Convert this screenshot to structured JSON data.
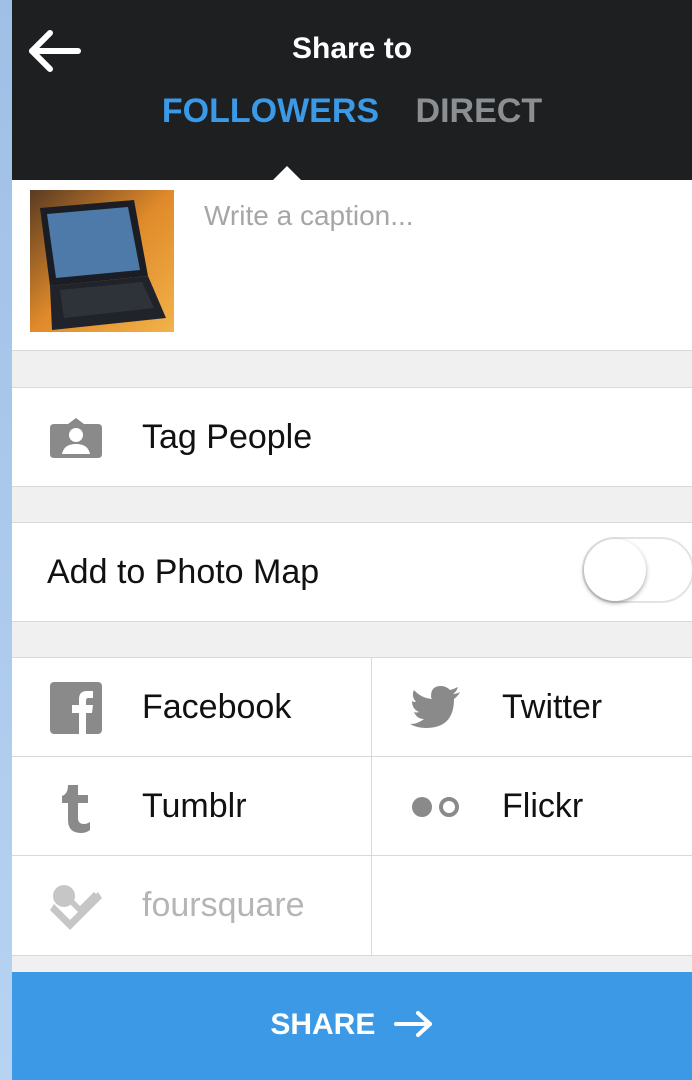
{
  "header": {
    "title": "Share to",
    "tabs": [
      {
        "label": "FOLLOWERS",
        "active": true
      },
      {
        "label": "DIRECT",
        "active": false
      }
    ]
  },
  "caption": {
    "placeholder": "Write a caption...",
    "value": ""
  },
  "tag_people": {
    "label": "Tag People",
    "icon": "person-tag-icon"
  },
  "photo_map": {
    "label": "Add to Photo Map",
    "enabled": false
  },
  "networks": [
    {
      "label": "Facebook",
      "icon": "facebook-icon",
      "enabled": true
    },
    {
      "label": "Twitter",
      "icon": "twitter-icon",
      "enabled": true
    },
    {
      "label": "Tumblr",
      "icon": "tumblr-icon",
      "enabled": true
    },
    {
      "label": "Flickr",
      "icon": "flickr-icon",
      "enabled": true
    },
    {
      "label": "foursquare",
      "icon": "foursquare-icon",
      "enabled": false
    }
  ],
  "share_button": {
    "label": "SHARE",
    "icon": "arrow-right-icon"
  },
  "colors": {
    "accent": "#3b99e6",
    "topbar": "#1d1f20",
    "muted_icon": "#8a8a8a"
  }
}
